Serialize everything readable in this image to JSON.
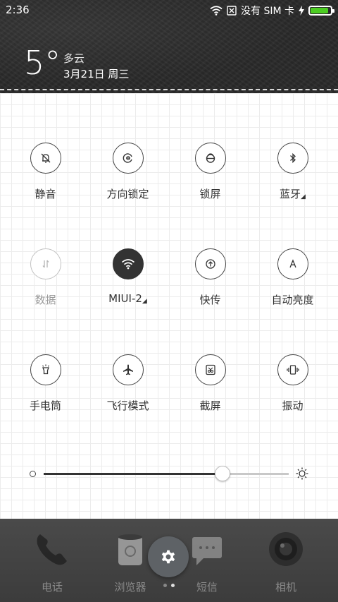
{
  "status_bar": {
    "time": "2:36",
    "carrier": "没有 SIM 卡",
    "battery_level": 0.9,
    "battery_color": "#4ccd22"
  },
  "weather": {
    "temperature": "5°",
    "condition": "多云",
    "date": "3月21日 周三"
  },
  "toggles": [
    {
      "label": "静音",
      "icon": "bell-off-icon",
      "state": "off"
    },
    {
      "label": "方向锁定",
      "icon": "rotation-lock-icon",
      "state": "off"
    },
    {
      "label": "锁屏",
      "icon": "lock-icon",
      "state": "off"
    },
    {
      "label": "蓝牙",
      "icon": "bluetooth-icon",
      "state": "off"
    },
    {
      "label": "数据",
      "icon": "data-arrows-icon",
      "state": "disabled"
    },
    {
      "label": "MIUI-2",
      "icon": "wifi-icon",
      "state": "on"
    },
    {
      "label": "快传",
      "icon": "transfer-icon",
      "state": "off"
    },
    {
      "label": "自动亮度",
      "icon": "auto-brightness-icon",
      "state": "off"
    },
    {
      "label": "手电筒",
      "icon": "flashlight-icon",
      "state": "off"
    },
    {
      "label": "飞行模式",
      "icon": "airplane-icon",
      "state": "off"
    },
    {
      "label": "截屏",
      "icon": "screenshot-icon",
      "state": "off"
    },
    {
      "label": "振动",
      "icon": "vibrate-icon",
      "state": "off"
    }
  ],
  "brightness": {
    "level": 0.73
  },
  "dock": {
    "apps": [
      {
        "label": "电话",
        "icon": "phone-icon"
      },
      {
        "label": "浏览器",
        "icon": "browser-icon"
      },
      {
        "label": "短信",
        "icon": "message-icon"
      },
      {
        "label": "相机",
        "icon": "camera-icon"
      }
    ],
    "settings_icon": "gear-icon",
    "page_count": 2,
    "active_page": 1
  }
}
